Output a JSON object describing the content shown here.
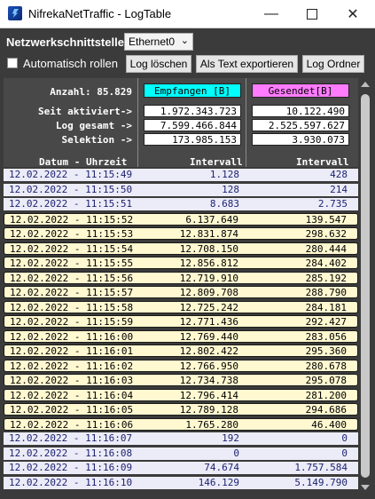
{
  "window": {
    "title": "NifrekaNetTraffic - LogTable",
    "minimize_icon": "—",
    "close_icon": "✕"
  },
  "toolbar": {
    "interface_label": "Netzwerkschnittstelle:",
    "interface_value": "Ethernet0",
    "chevron": "⌄",
    "auto_scroll_label": "Automatisch rollen",
    "auto_scroll_checked": false,
    "clear_log_label": "Log löschen",
    "export_label": "Als Text exportieren",
    "log_folder_label": "Log Ordner"
  },
  "summary": {
    "count_label": "Anzahl: 85.829",
    "received_header": "Empfangen [B]",
    "sent_header": "Gesendet[B]",
    "received_color": "#00ffff",
    "sent_color": "#ff7bff",
    "since_label": "Seit aktiviert->",
    "since_received": "1.972.343.723",
    "since_sent": "10.122.490",
    "total_label": "Log gesamt ->",
    "total_received": "7.599.466.844",
    "total_sent": "2.525.597.627",
    "selection_label": "Selektion ->",
    "selection_received": "173.985.153",
    "selection_sent": "3.930.073",
    "col_datetime": "Datum - Uhrzeit",
    "col_interval_1": "Intervall",
    "col_interval_2": "Intervall"
  },
  "rows": [
    {
      "dt": "12.02.2022 - 11:15:49",
      "rx": "1.128",
      "tx": "428",
      "sel": false
    },
    {
      "dt": "12.02.2022 - 11:15:50",
      "rx": "128",
      "tx": "214",
      "sel": false
    },
    {
      "dt": "12.02.2022 - 11:15:51",
      "rx": "8.683",
      "tx": "2.735",
      "sel": false
    },
    {
      "dt": "12.02.2022 - 11:15:52",
      "rx": "6.137.649",
      "tx": "139.547",
      "sel": true
    },
    {
      "dt": "12.02.2022 - 11:15:53",
      "rx": "12.831.874",
      "tx": "298.632",
      "sel": true
    },
    {
      "dt": "12.02.2022 - 11:15:54",
      "rx": "12.708.150",
      "tx": "280.444",
      "sel": true
    },
    {
      "dt": "12.02.2022 - 11:15:55",
      "rx": "12.856.812",
      "tx": "284.402",
      "sel": true
    },
    {
      "dt": "12.02.2022 - 11:15:56",
      "rx": "12.719.910",
      "tx": "285.192",
      "sel": true
    },
    {
      "dt": "12.02.2022 - 11:15:57",
      "rx": "12.809.708",
      "tx": "288.790",
      "sel": true
    },
    {
      "dt": "12.02.2022 - 11:15:58",
      "rx": "12.725.242",
      "tx": "284.181",
      "sel": true
    },
    {
      "dt": "12.02.2022 - 11:15:59",
      "rx": "12.771.436",
      "tx": "292.427",
      "sel": true
    },
    {
      "dt": "12.02.2022 - 11:16:00",
      "rx": "12.769.440",
      "tx": "283.056",
      "sel": true
    },
    {
      "dt": "12.02.2022 - 11:16:01",
      "rx": "12.802.422",
      "tx": "295.360",
      "sel": true
    },
    {
      "dt": "12.02.2022 - 11:16:02",
      "rx": "12.766.950",
      "tx": "280.678",
      "sel": true
    },
    {
      "dt": "12.02.2022 - 11:16:03",
      "rx": "12.734.738",
      "tx": "295.078",
      "sel": true
    },
    {
      "dt": "12.02.2022 - 11:16:04",
      "rx": "12.796.414",
      "tx": "281.200",
      "sel": true
    },
    {
      "dt": "12.02.2022 - 11:16:05",
      "rx": "12.789.128",
      "tx": "294.686",
      "sel": true
    },
    {
      "dt": "12.02.2022 - 11:16:06",
      "rx": "1.765.280",
      "tx": "46.400",
      "sel": true
    },
    {
      "dt": "12.02.2022 - 11:16:07",
      "rx": "192",
      "tx": "0",
      "sel": false
    },
    {
      "dt": "12.02.2022 - 11:16:08",
      "rx": "0",
      "tx": "0",
      "sel": false
    },
    {
      "dt": "12.02.2022 - 11:16:09",
      "rx": "74.674",
      "tx": "1.757.584",
      "sel": false
    },
    {
      "dt": "12.02.2022 - 11:16:10",
      "rx": "146.129",
      "tx": "5.149.790",
      "sel": false
    }
  ]
}
